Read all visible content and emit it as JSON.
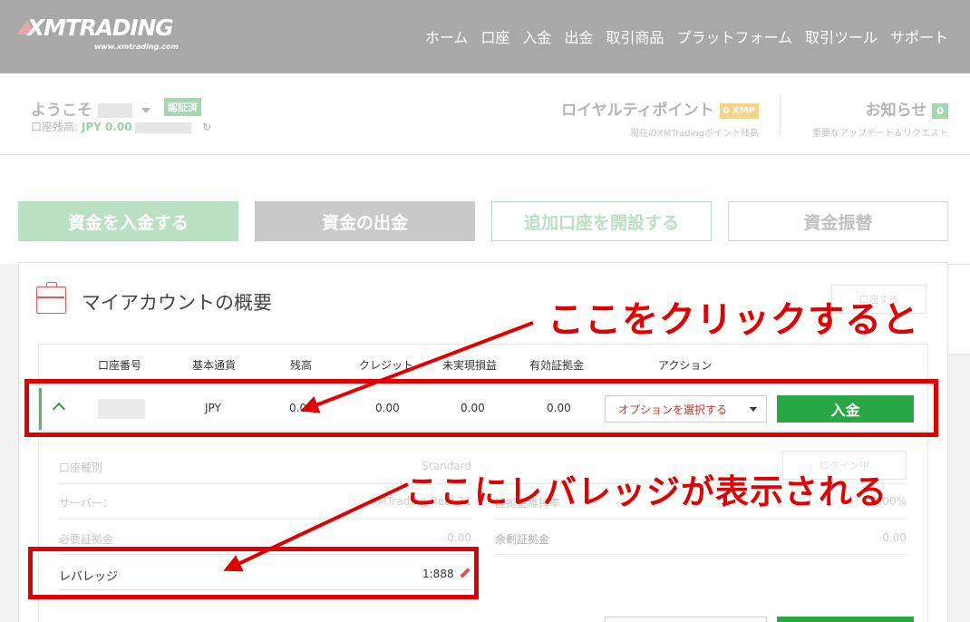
{
  "header": {
    "logo_text": "XMTRADING",
    "logo_sub": "www.xmtrading.com",
    "nav": [
      "ホーム",
      "口座",
      "入金",
      "出金",
      "取引商品",
      "プラットフォーム",
      "取引ツール",
      "サポート"
    ]
  },
  "infobar": {
    "welcome": "ようこそ",
    "verified": "認証済",
    "balance_label": "口座残高:",
    "balance_value": "JPY 0.00",
    "loyalty_title": "ロイヤルティポイント",
    "loyalty_badge": "0 XMP",
    "loyalty_sub": "現在のXMTradingポイント残高",
    "news_title": "お知らせ",
    "news_badge": "0",
    "news_sub": "重要なアップデート＆リクエスト"
  },
  "actions": {
    "deposit": "資金を入金する",
    "withdraw": "資金の出金",
    "open_account": "追加口座を開設する",
    "transfer": "資金振替"
  },
  "panel": {
    "title": "マイアカウントの概要",
    "ghost_button": "口座する"
  },
  "table": {
    "headers": [
      "口座番号",
      "基本通貨",
      "残高",
      "クレジット",
      "未実現損益",
      "有効証拠金",
      "アクション"
    ],
    "row": {
      "currency": "JPY",
      "balance": "0.00",
      "credit": "0.00",
      "unrealized": "0.00",
      "equity": "0.00",
      "select_label": "オプションを選択する",
      "deposit_label": "入金"
    }
  },
  "details": {
    "account_type_label": "口座種別",
    "account_type_value": "Standard",
    "server_label": "サーバー：",
    "server_value": "XMTrading-Real 31",
    "required_margin_label": "必要証拠金",
    "required_margin_value": "0.00",
    "margin_level_label": "証拠金維持率",
    "margin_level_value": "0.00%",
    "free_margin_label": "余剰証拠金",
    "free_margin_value": "0.00",
    "login_button": "ログイン中",
    "leverage_label": "レバレッジ",
    "leverage_value": "1:888"
  },
  "annotations": {
    "click_here": "ここをクリックすると",
    "leverage_shown": "ここにレバレッジが表示される",
    "color": "#e00000"
  },
  "colors": {
    "header_bg": "#a8a8a8",
    "green": "#27a844",
    "red_text": "#c0392b"
  }
}
